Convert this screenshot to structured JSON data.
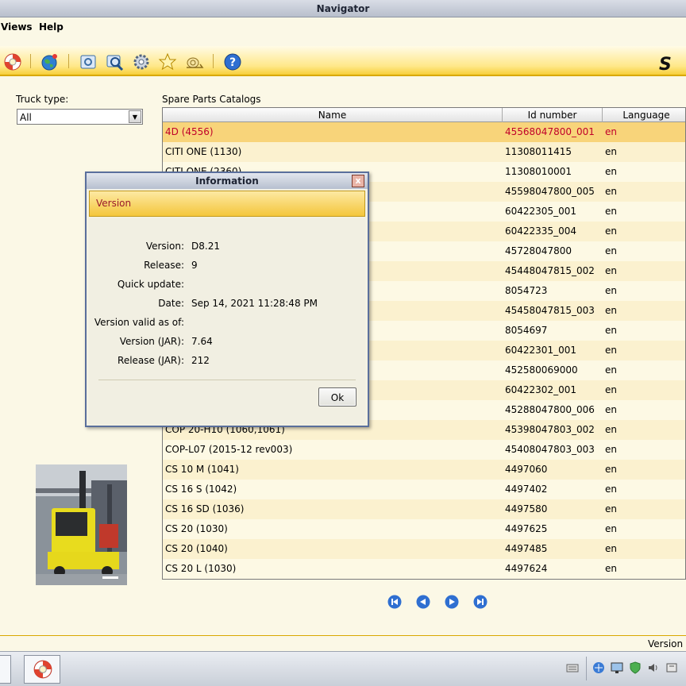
{
  "window": {
    "title": "Navigator"
  },
  "menu": {
    "items": [
      "Views",
      "Help"
    ]
  },
  "toolbar": {
    "icons": [
      "lifebuoy-icon",
      "globe-icon",
      "parts-book-icon",
      "search-parts-icon",
      "gear-icon",
      "star-icon",
      "snail-icon",
      "help-icon"
    ],
    "brand": "S"
  },
  "filter": {
    "label": "Truck type:",
    "value": "All"
  },
  "catalog": {
    "label": "Spare Parts Catalogs",
    "columns": [
      "Name",
      "Id number",
      "Language"
    ],
    "rows": [
      {
        "name": "4D (4556)",
        "id": "45568047800_001",
        "lang": "en",
        "selected": true
      },
      {
        "name": "CITI ONE (1130)",
        "id": "11308011415",
        "lang": "en"
      },
      {
        "name": "CITI ONE (2360)",
        "id": "11308010001",
        "lang": "en"
      },
      {
        "name": "",
        "id": "45598047800_005",
        "lang": "en"
      },
      {
        "name": "",
        "id": "60422305_001",
        "lang": "en"
      },
      {
        "name": "",
        "id": "60422335_004",
        "lang": "en"
      },
      {
        "name": "",
        "id": "45728047800",
        "lang": "en"
      },
      {
        "name": "",
        "id": "45448047815_002",
        "lang": "en"
      },
      {
        "name": "",
        "id": "8054723",
        "lang": "en"
      },
      {
        "name": "",
        "id": "45458047815_003",
        "lang": "en"
      },
      {
        "name": "",
        "id": "8054697",
        "lang": "en"
      },
      {
        "name": "",
        "id": "60422301_001",
        "lang": "en"
      },
      {
        "name": "",
        "id": "452580069000",
        "lang": "en"
      },
      {
        "name": "",
        "id": "60422302_001",
        "lang": "en"
      },
      {
        "name": "",
        "id": "45288047800_006",
        "lang": "en"
      },
      {
        "name": "COP 20-H10 (1060,1061)",
        "id": "45398047803_002",
        "lang": "en"
      },
      {
        "name": "COP-L07 (2015-12 rev003)",
        "id": "45408047803_003",
        "lang": "en"
      },
      {
        "name": "CS 10 M (1041)",
        "id": "4497060",
        "lang": "en"
      },
      {
        "name": "CS 16 S (1042)",
        "id": "4497402",
        "lang": "en"
      },
      {
        "name": "CS 16 SD (1036)",
        "id": "4497580",
        "lang": "en"
      },
      {
        "name": "CS 20 (1030)",
        "id": "4497625",
        "lang": "en"
      },
      {
        "name": "CS 20 (1040)",
        "id": "4497485",
        "lang": "en"
      },
      {
        "name": "CS 20 L (1030)",
        "id": "4497624",
        "lang": "en"
      }
    ]
  },
  "pager": {
    "icons": [
      "first-page-icon",
      "prev-page-icon",
      "next-page-icon",
      "last-page-icon"
    ]
  },
  "status": {
    "text": "Version D"
  },
  "dialog": {
    "title": "Information",
    "close": "x",
    "banner": "Version",
    "fields": [
      {
        "label": "Version:",
        "value": "D8.21"
      },
      {
        "label": "Release:",
        "value": "9"
      },
      {
        "label": "Quick update:",
        "value": ""
      },
      {
        "label": "Date:",
        "value": "Sep 14, 2021 11:28:48 PM"
      },
      {
        "label": "Version valid as of:",
        "value": ""
      },
      {
        "label": "Version (JAR):",
        "value": "7.64"
      },
      {
        "label": "Release (JAR):",
        "value": "212"
      }
    ],
    "ok_label": "Ok"
  },
  "colors": {
    "accent": "#f7cf3a",
    "selected_row": "#f8d47a",
    "selected_text": "#c0002a"
  }
}
